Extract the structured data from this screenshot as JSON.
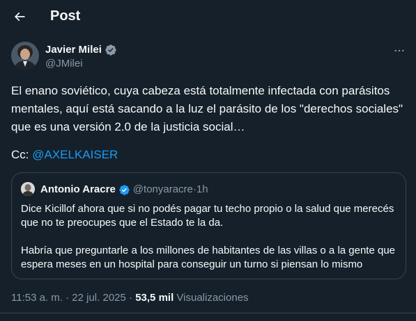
{
  "header": {
    "title": "Post",
    "back_icon": "arrow-left-icon"
  },
  "author": {
    "name": "Javier Milei",
    "handle": "@JMilei",
    "verified_color": "#1d9bf0"
  },
  "tweet": {
    "text": "El enano soviético, cuya cabeza está totalmente infectada con parásitos mentales, aquí está sacando a la luz el parásito de los \"derechos sociales\" que es una versión 2.0 de la justicia social…",
    "cc_prefix": "Cc: ",
    "cc_mention": "@AXELKAISER"
  },
  "quote": {
    "name": "Antonio Aracre",
    "handle": "@tonyaracre",
    "separator": " · ",
    "time": "1h",
    "paragraphs": [
      "Dice Kicillof ahora que si no podés pagar tu techo propio o la salud que merecés que no te preocupes que el Estado te la da.",
      "Habría que preguntarle a los millones de habitantes de las villas o a la gente que espera meses en un hospital para conseguir un turno si piensan lo mismo"
    ]
  },
  "meta": {
    "time": "11:53 a. m.",
    "sep1": " · ",
    "date": "22 jul. 2025",
    "sep2": " · ",
    "views_count": "53,5 mil",
    "views_label": " Visualizaciones"
  },
  "colors": {
    "background": "#15202b",
    "text": "#f7f9f9",
    "secondary": "#8b98a5",
    "accent": "#1d9bf0",
    "border": "#38444d"
  }
}
